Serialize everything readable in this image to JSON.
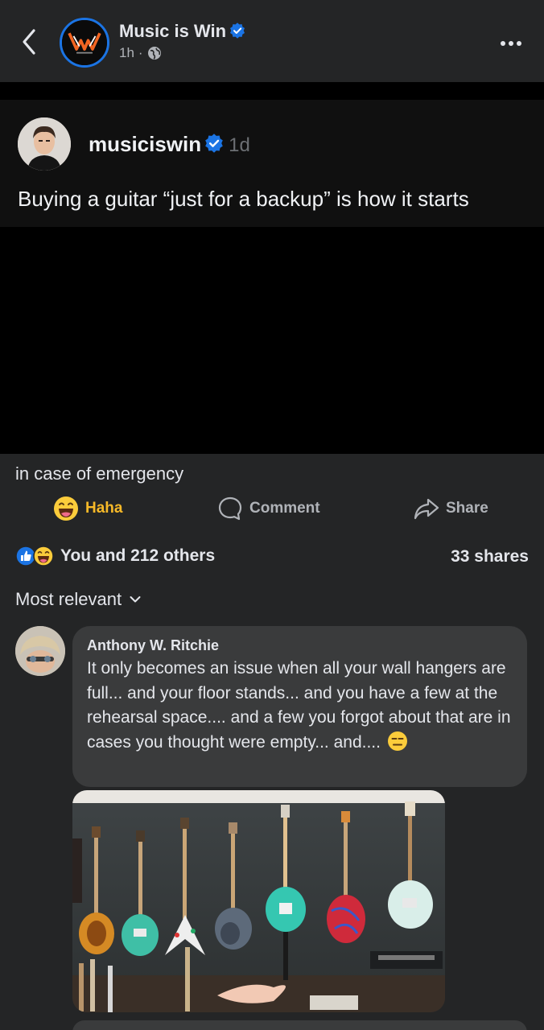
{
  "header": {
    "page_name": "Music is Win",
    "time": "1h",
    "separator": "·"
  },
  "shared_post": {
    "username": "musiciswin",
    "time": "1d",
    "text": "Buying a guitar “just for a backup” is how it starts"
  },
  "post": {
    "caption": "in case of emergency"
  },
  "actions": {
    "reaction_label": "Haha",
    "comment_label": "Comment",
    "share_label": "Share"
  },
  "stats": {
    "reactions_text": "You and 212 others",
    "shares_text": "33 shares"
  },
  "comments": {
    "sort_label": "Most relevant",
    "items": [
      {
        "author": "Anthony W. Ritchie",
        "text": "It only becomes an issue when all your wall hangers are full... and your floor stands... and you have a few at the rehearsal space.... and a few you forgot about that are in cases you thought were empty... and...."
      }
    ]
  },
  "colors": {
    "background": "#242526",
    "verified_blue": "#1b74e4",
    "haha_yellow": "#f7b928",
    "bubble": "#3a3b3c"
  },
  "icons": {
    "back": "chevron-left-icon",
    "more": "more-horizontal-icon",
    "globe": "globe-icon",
    "verified": "verified-badge-icon",
    "haha": "haha-emoji-icon",
    "comment": "comment-bubble-icon",
    "share": "share-arrow-icon",
    "like": "like-reaction-icon",
    "expressionless": "expressionless-emoji-icon"
  }
}
